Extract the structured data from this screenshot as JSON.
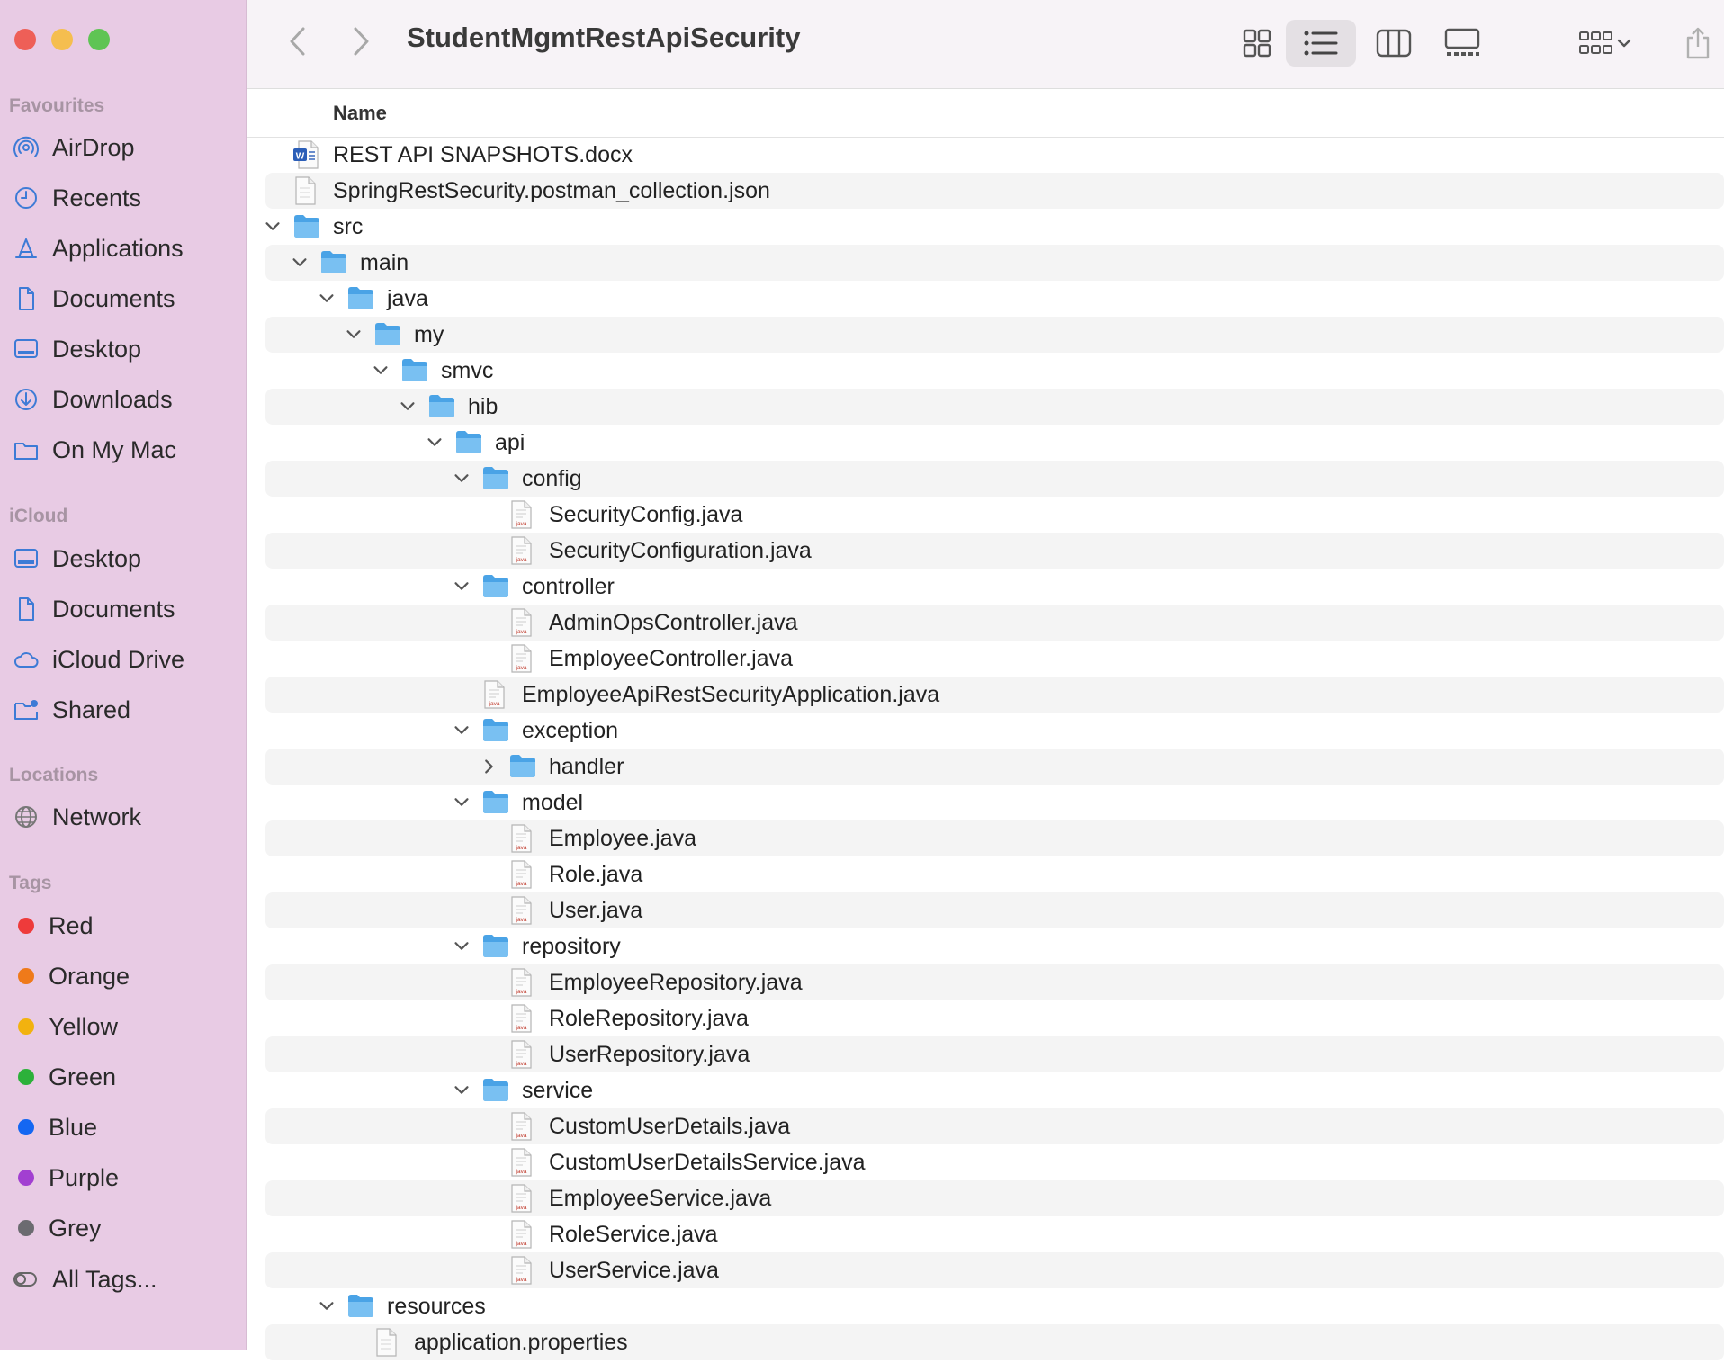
{
  "window": {
    "title": "StudentMgmtRestApiSecurity"
  },
  "sidebar": {
    "favourites_title": "Favourites",
    "favourites": [
      {
        "label": "AirDrop",
        "icon": "airdrop-icon"
      },
      {
        "label": "Recents",
        "icon": "clock-icon"
      },
      {
        "label": "Applications",
        "icon": "applications-icon"
      },
      {
        "label": "Documents",
        "icon": "document-icon"
      },
      {
        "label": "Desktop",
        "icon": "desktop-icon"
      },
      {
        "label": "Downloads",
        "icon": "download-icon"
      },
      {
        "label": "On My Mac",
        "icon": "folder-icon"
      }
    ],
    "icloud_title": "iCloud",
    "icloud": [
      {
        "label": "Desktop",
        "icon": "desktop-icon"
      },
      {
        "label": "Documents",
        "icon": "document-icon"
      },
      {
        "label": "iCloud Drive",
        "icon": "cloud-icon"
      },
      {
        "label": "Shared",
        "icon": "shared-folder-icon"
      }
    ],
    "locations_title": "Locations",
    "locations": [
      {
        "label": "Network",
        "icon": "globe-icon"
      }
    ],
    "tags_title": "Tags",
    "tags": [
      {
        "label": "Red",
        "color": "#ee3b3b"
      },
      {
        "label": "Orange",
        "color": "#ef7a1a"
      },
      {
        "label": "Yellow",
        "color": "#f2b20f"
      },
      {
        "label": "Green",
        "color": "#2cb13a"
      },
      {
        "label": "Blue",
        "color": "#1467f2"
      },
      {
        "label": "Purple",
        "color": "#a23fd1"
      },
      {
        "label": "Grey",
        "color": "#6b6b70"
      }
    ],
    "all_tags_label": "All Tags..."
  },
  "column_header": {
    "name": "Name"
  },
  "files": [
    {
      "name": "REST API SNAPSHOTS.docx",
      "level": 0,
      "type": "docx"
    },
    {
      "name": "SpringRestSecurity.postman_collection.json",
      "level": 0,
      "type": "file"
    },
    {
      "name": "src",
      "level": 0,
      "type": "folder",
      "state": "expanded"
    },
    {
      "name": "main",
      "level": 1,
      "type": "folder",
      "state": "expanded"
    },
    {
      "name": "java",
      "level": 2,
      "type": "folder",
      "state": "expanded"
    },
    {
      "name": "my",
      "level": 3,
      "type": "folder",
      "state": "expanded"
    },
    {
      "name": "smvc",
      "level": 4,
      "type": "folder",
      "state": "expanded"
    },
    {
      "name": "hib",
      "level": 5,
      "type": "folder",
      "state": "expanded"
    },
    {
      "name": "api",
      "level": 6,
      "type": "folder",
      "state": "expanded"
    },
    {
      "name": "config",
      "level": 7,
      "type": "folder",
      "state": "expanded"
    },
    {
      "name": "SecurityConfig.java",
      "level": 8,
      "type": "java"
    },
    {
      "name": "SecurityConfiguration.java",
      "level": 8,
      "type": "java"
    },
    {
      "name": "controller",
      "level": 7,
      "type": "folder",
      "state": "expanded"
    },
    {
      "name": "AdminOpsController.java",
      "level": 8,
      "type": "java"
    },
    {
      "name": "EmployeeController.java",
      "level": 8,
      "type": "java"
    },
    {
      "name": "EmployeeApiRestSecurityApplication.java",
      "level": 7,
      "type": "java"
    },
    {
      "name": "exception",
      "level": 7,
      "type": "folder",
      "state": "expanded"
    },
    {
      "name": "handler",
      "level": 8,
      "type": "folder",
      "state": "collapsed"
    },
    {
      "name": "model",
      "level": 7,
      "type": "folder",
      "state": "expanded"
    },
    {
      "name": "Employee.java",
      "level": 8,
      "type": "java"
    },
    {
      "name": "Role.java",
      "level": 8,
      "type": "java"
    },
    {
      "name": "User.java",
      "level": 8,
      "type": "java"
    },
    {
      "name": "repository",
      "level": 7,
      "type": "folder",
      "state": "expanded"
    },
    {
      "name": "EmployeeRepository.java",
      "level": 8,
      "type": "java"
    },
    {
      "name": "RoleRepository.java",
      "level": 8,
      "type": "java"
    },
    {
      "name": "UserRepository.java",
      "level": 8,
      "type": "java"
    },
    {
      "name": "service",
      "level": 7,
      "type": "folder",
      "state": "expanded"
    },
    {
      "name": "CustomUserDetails.java",
      "level": 8,
      "type": "java"
    },
    {
      "name": "CustomUserDetailsService.java",
      "level": 8,
      "type": "java"
    },
    {
      "name": "EmployeeService.java",
      "level": 8,
      "type": "java"
    },
    {
      "name": "RoleService.java",
      "level": 8,
      "type": "java"
    },
    {
      "name": "UserService.java",
      "level": 8,
      "type": "java"
    },
    {
      "name": "resources",
      "level": 2,
      "type": "folder",
      "state": "expanded"
    },
    {
      "name": "application.properties",
      "level": 3,
      "type": "file"
    }
  ]
}
